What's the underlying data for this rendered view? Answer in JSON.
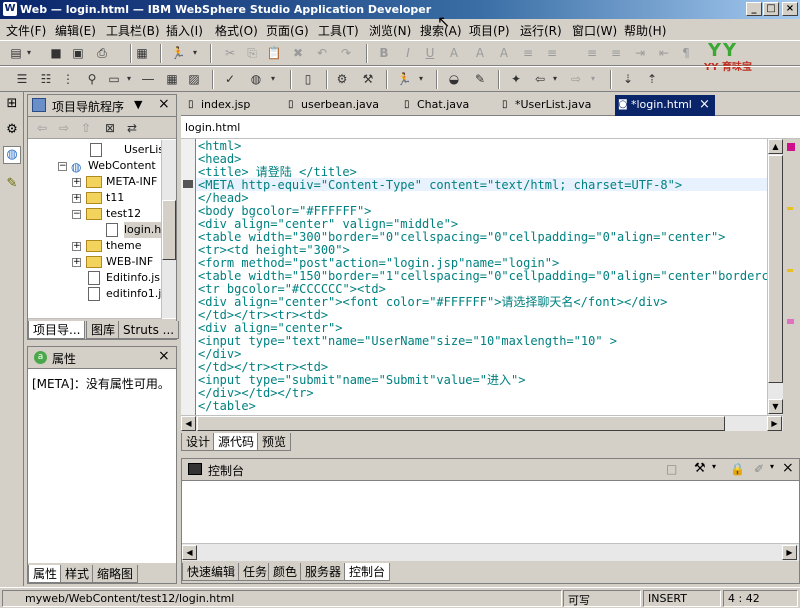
{
  "title": "Web — login.html — IBM WebSphere Studio Application Developer",
  "window_controls": {
    "minimize": "_",
    "maximize": "□",
    "close": "×"
  },
  "menu": [
    "文件(F)",
    "编辑(E)",
    "工具栏(B)",
    "插入(I)",
    "格式(O)",
    "页面(G)",
    "工具(T)",
    "浏览(N)",
    "搜索(A)",
    "项目(P)",
    "运行(R)",
    "窗口(W)",
    "帮助(H)"
  ],
  "logo_text": "YY 育味宝",
  "navigator": {
    "title": "项目导航程序",
    "items": [
      {
        "label": "UserLis"
      },
      {
        "label": "WebContent"
      },
      {
        "label": "META-INF"
      },
      {
        "label": "t11"
      },
      {
        "label": "test12"
      },
      {
        "label": "login.ht"
      },
      {
        "label": "theme"
      },
      {
        "label": "WEB-INF"
      },
      {
        "label": "Editinfo.jsp"
      },
      {
        "label": "editinfo1.js"
      }
    ],
    "tabs": [
      "项目导...",
      "图库",
      "Struts ..."
    ]
  },
  "properties": {
    "title": "属性",
    "message": "[META]：没有属性可用。",
    "tabs": [
      "属性",
      "样式",
      "缩略图"
    ]
  },
  "editor": {
    "tabs": [
      "index.jsp",
      "userbean.java",
      "Chat.java",
      "*UserList.java",
      "*login.html"
    ],
    "file_label": "login.html",
    "lines": [
      "<html>",
      "<head>",
      "<title> 请登陆 </title>",
      "<META http-equiv=\"Content-Type\" content=\"text/html; charset=UTF-8\">",
      "</head>",
      "<body bgcolor=\"#FFFFFF\">",
      "<div align=\"center\" valign=\"middle\">",
      "<table width=\"300\"border=\"0\"cellspacing=\"0\"cellpadding=\"0\"align=\"center\">",
      "<tr><td height=\"300\">",
      "<form method=\"post\"action=\"login.jsp\"name=\"login\">",
      "<table width=\"150\"border=\"1\"cellspacing=\"0\"cellpadding=\"0\"align=\"center\"bordercolo",
      "<tr bgcolor=\"#CCCCCC\"><td>",
      "<div align=\"center\"><font color=\"#FFFFFF\">请选择聊天名</font></div>",
      "</td></tr><tr><td>",
      "<div align=\"center\">",
      "<input type=\"text\"name=\"UserName\"size=\"10\"maxlength=\"10\" >",
      "</div>",
      "</td></tr><tr><td>",
      "<input type=\"submit\"name=\"Submit\"value=\"进入\">",
      "</div></td></tr>",
      "</table>"
    ],
    "view_tabs": [
      "设计",
      "源代码",
      "预览"
    ]
  },
  "console": {
    "title": "控制台",
    "tabs": [
      "快速编辑",
      "任务",
      "颜色",
      "服务器",
      "控制台"
    ]
  },
  "status": {
    "path": "myweb/WebContent/test12/login.html",
    "writable": "可写",
    "mode": "INSERT",
    "position": "4 : 42"
  },
  "colors": {
    "titlebar": "#0a246a",
    "active_tab": "#0a246a",
    "code_teal": "#008080"
  }
}
